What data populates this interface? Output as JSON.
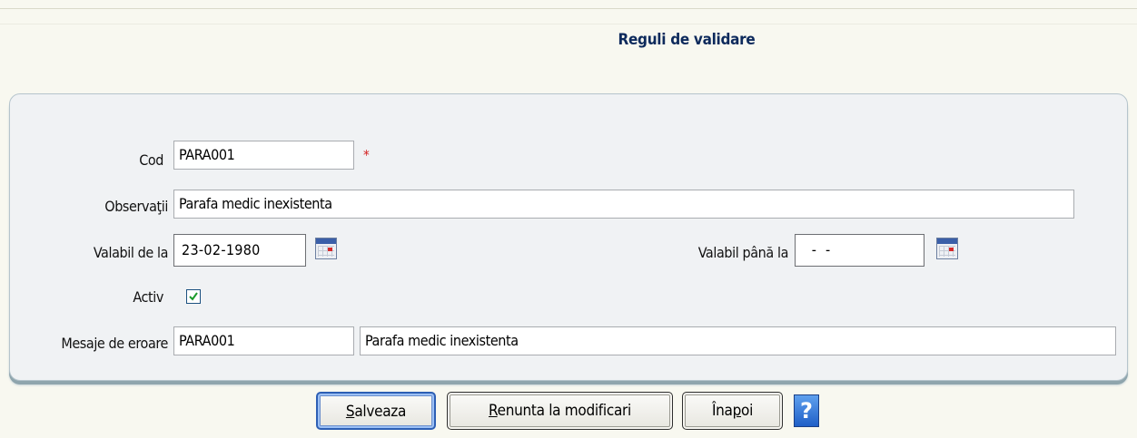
{
  "page": {
    "title": "Reguli de validare"
  },
  "form": {
    "cod": {
      "label": "Cod",
      "value": "PARA001",
      "required_mark": "*"
    },
    "observatii": {
      "label": "Observaţii",
      "value": "Parafa medic inexistenta"
    },
    "valabil_de_la": {
      "label": "Valabil de la",
      "value": "23-02-1980"
    },
    "valabil_pana_la": {
      "label": "Valabil până la",
      "value": "  -  -"
    },
    "activ": {
      "label": "Activ",
      "checked": true
    },
    "mesaje": {
      "label": "Mesaje de eroare",
      "code": "PARA001",
      "text": "Parafa medic inexistenta"
    }
  },
  "buttons": {
    "save": {
      "first": "S",
      "rest": "alveaza"
    },
    "cancel": {
      "first": "R",
      "rest": "enunta la modificari"
    },
    "back": {
      "pre": "Îna",
      "ul": "p",
      "post": "oi"
    },
    "help": "?"
  },
  "colors": {
    "title": "#0d2a5c",
    "required": "#d42020",
    "accent": "#2d5fb4"
  }
}
